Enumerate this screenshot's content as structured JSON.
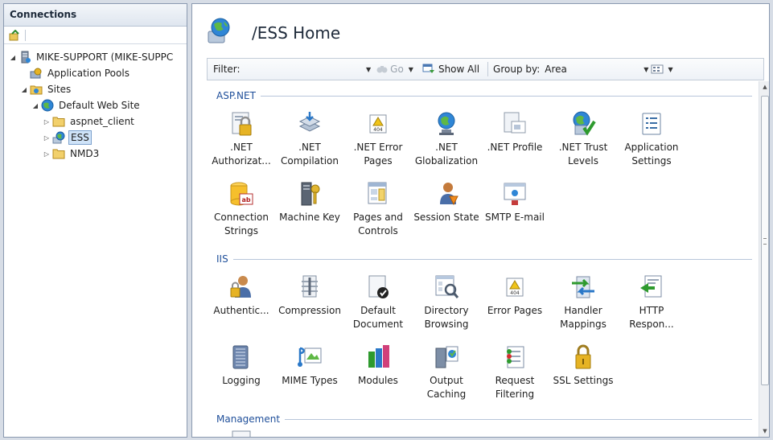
{
  "connections": {
    "header": "Connections",
    "tree": [
      {
        "label": "MIKE-SUPPORT (MIKE-SUPPC",
        "icon": "server-icon",
        "indent": 0,
        "expander": "◢"
      },
      {
        "label": "Application Pools",
        "icon": "app-pools-icon",
        "indent": 1,
        "expander": ""
      },
      {
        "label": "Sites",
        "icon": "sites-folder-icon",
        "indent": 1,
        "expander": "◢"
      },
      {
        "label": "Default Web Site",
        "icon": "globe-icon",
        "indent": 2,
        "expander": "◢"
      },
      {
        "label": "aspnet_client",
        "icon": "folder-icon",
        "indent": 3,
        "expander": "▷"
      },
      {
        "label": "ESS",
        "icon": "app-globe-icon",
        "indent": 3,
        "expander": "▷",
        "selected": true
      },
      {
        "label": "NMD3",
        "icon": "folder-icon",
        "indent": 3,
        "expander": "▷"
      }
    ]
  },
  "main": {
    "title": "/ESS Home",
    "filter": {
      "label": "Filter:",
      "value": "",
      "go_label": "Go",
      "show_all_label": "Show All",
      "group_by_label": "Group by:",
      "group_by_value": "Area"
    },
    "sections": [
      {
        "title": "ASP.NET",
        "features": [
          {
            "label": ".NET\nAuthorizat...",
            "icon": "net-authorization-icon"
          },
          {
            "label": ".NET\nCompilation",
            "icon": "net-compilation-icon"
          },
          {
            "label": ".NET Error\nPages",
            "icon": "net-error-pages-icon"
          },
          {
            "label": ".NET\nGlobalization",
            "icon": "net-globalization-icon"
          },
          {
            "label": ".NET Profile",
            "icon": "net-profile-icon"
          },
          {
            "label": ".NET Trust\nLevels",
            "icon": "net-trust-levels-icon"
          },
          {
            "label": "Application\nSettings",
            "icon": "application-settings-icon"
          },
          {
            "label": "Connection\nStrings",
            "icon": "connection-strings-icon"
          },
          {
            "label": "Machine Key",
            "icon": "machine-key-icon"
          },
          {
            "label": "Pages and\nControls",
            "icon": "pages-controls-icon"
          },
          {
            "label": "Session State",
            "icon": "session-state-icon"
          },
          {
            "label": "SMTP E-mail",
            "icon": "smtp-email-icon"
          }
        ]
      },
      {
        "title": "IIS",
        "features": [
          {
            "label": "Authentic...",
            "icon": "authentication-icon"
          },
          {
            "label": "Compression",
            "icon": "compression-icon"
          },
          {
            "label": "Default\nDocument",
            "icon": "default-document-icon"
          },
          {
            "label": "Directory\nBrowsing",
            "icon": "directory-browsing-icon"
          },
          {
            "label": "Error Pages",
            "icon": "error-pages-icon"
          },
          {
            "label": "Handler\nMappings",
            "icon": "handler-mappings-icon"
          },
          {
            "label": "HTTP\nRespon...",
            "icon": "http-response-icon"
          },
          {
            "label": "Logging",
            "icon": "logging-icon"
          },
          {
            "label": "MIME Types",
            "icon": "mime-types-icon"
          },
          {
            "label": "Modules",
            "icon": "modules-icon"
          },
          {
            "label": "Output\nCaching",
            "icon": "output-caching-icon"
          },
          {
            "label": "Request\nFiltering",
            "icon": "request-filtering-icon"
          },
          {
            "label": "SSL Settings",
            "icon": "ssl-settings-icon"
          }
        ]
      },
      {
        "title": "Management",
        "features": []
      }
    ]
  },
  "colors": {
    "section_title": "#1f4f9a",
    "selection": "#cfe3f8",
    "frame": "#d7dde6"
  }
}
